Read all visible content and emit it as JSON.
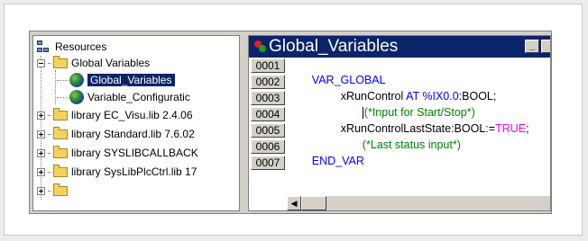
{
  "tree": {
    "items": [
      {
        "label": "Resources",
        "icon": "resources-icon"
      },
      {
        "label": "Global Variables",
        "icon": "folder-icon"
      },
      {
        "label": "Global_Variables",
        "icon": "globe-icon",
        "selected": true
      },
      {
        "label": "Variable_Configuratic",
        "icon": "globe-icon"
      },
      {
        "label": "library EC_Visu.lib 2.4.06",
        "icon": "folder-icon"
      },
      {
        "label": "library Standard.lib 7.6.02",
        "icon": "folder-icon"
      },
      {
        "label": "library SYSLIBCALLBACK",
        "icon": "folder-icon"
      },
      {
        "label": "library SysLibPlcCtrl.lib 17",
        "icon": "folder-icon"
      }
    ]
  },
  "editor": {
    "title": "Global_Variables",
    "minimize_label": "_",
    "line_numbers": [
      "0001",
      "0002",
      "0003",
      "0004",
      "0005",
      "0006",
      "0007"
    ],
    "lines": {
      "l1_kw": "VAR_GLOBAL",
      "l2_a": "xRunControl ",
      "l2_kw": "AT %IX0.0",
      "l2_b": ":BOOL;",
      "l3_cm": "(*Input for Start/Stop*)",
      "l4_a": "xRunControlLastState:BOOL:=",
      "l4_kw": "TRUE",
      "l4_b": ";",
      "l5_cm": "(*Last status input*)",
      "l6_kw": "END_VAR"
    }
  },
  "colors": {
    "selection": "#0a246a",
    "keyword": "#0000ff",
    "comment": "#008000",
    "titlebar": "#0a246a"
  }
}
